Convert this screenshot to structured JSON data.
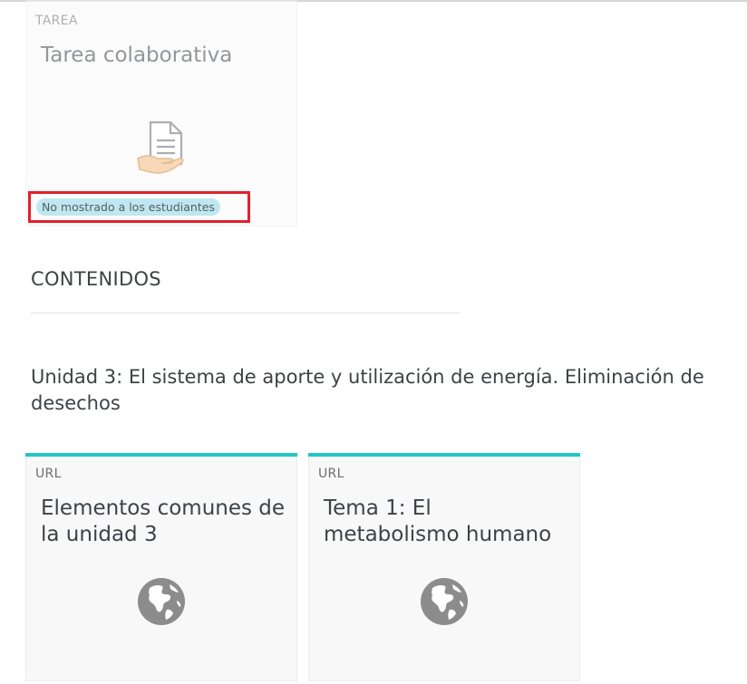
{
  "cards_top": [
    {
      "type": "TAREA",
      "title": "Tarea colaborativa",
      "icon": "assignment-hand-icon",
      "badge": "No mostrado a los estudiantes"
    }
  ],
  "section": {
    "title": "CONTENIDOS"
  },
  "unit": {
    "title": "Unidad 3: El sistema de aporte y utilización de energía. Eliminación de desechos"
  },
  "cards_unit": [
    {
      "type": "URL",
      "title": "Elementos comunes de la unidad 3",
      "icon": "globe-icon"
    },
    {
      "type": "URL",
      "title": "Tema 1: El metabolismo humano",
      "icon": "globe-icon"
    }
  ],
  "colors": {
    "accent_teal": "#1fc8c4",
    "highlight_red": "#e2212b",
    "badge_bg": "#bfe7ef"
  }
}
